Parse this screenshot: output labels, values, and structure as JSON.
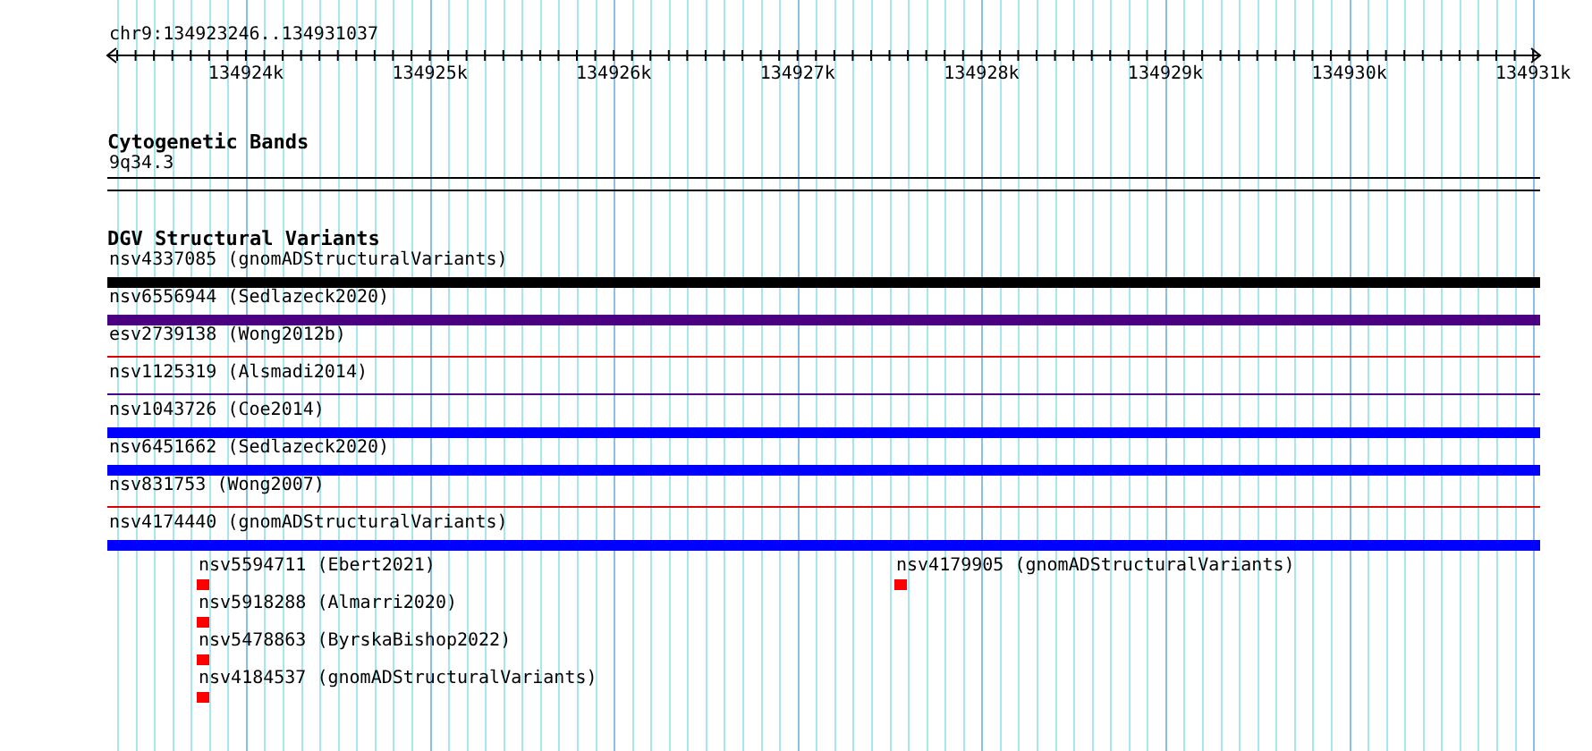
{
  "ruler": {
    "position": "chr9:134923246..134931037",
    "ticks": [
      "134924k",
      "134925k",
      "134926k",
      "134927k",
      "134928k",
      "134929k",
      "134930k",
      "134931k"
    ]
  },
  "cytogenetic_bands": {
    "title": "Cytogenetic Bands",
    "band": "9q34.3"
  },
  "dgv_track": {
    "title": "DGV Structural Variants",
    "variants": [
      {
        "label": "nsv4337085 (gnomADStructuralVariants)",
        "kind": "thick",
        "color": "#000000"
      },
      {
        "label": "nsv6556944 (Sedlazeck2020)",
        "kind": "thick",
        "color": "#4b0082"
      },
      {
        "label": "esv2739138 (Wong2012b)",
        "kind": "thin",
        "color": "#dd0000"
      },
      {
        "label": "nsv1125319 (Alsmadi2014)",
        "kind": "thin",
        "color": "#4b0082"
      },
      {
        "label": "nsv1043726 (Coe2014)",
        "kind": "thick",
        "color": "#0000ff"
      },
      {
        "label": "nsv6451662 (Sedlazeck2020)",
        "kind": "thick",
        "color": "#0000ff"
      },
      {
        "label": "nsv831753 (Wong2007)",
        "kind": "thin",
        "color": "#dd0000"
      },
      {
        "label": "nsv4174440 (gnomADStructuralVariants)",
        "kind": "thick",
        "color": "#0000ff"
      }
    ],
    "small_variant_groups": [
      {
        "items": [
          {
            "label": "nsv5594711 (Ebert2021)",
            "color": "#ff0000"
          },
          {
            "label": "nsv5918288 (Almarri2020)",
            "color": "#ff0000"
          },
          {
            "label": "nsv5478863 (ByrskaBishop2022)",
            "color": "#ff0000"
          },
          {
            "label": "nsv4184537 (gnomADStructuralVariants)",
            "color": "#ff0000"
          }
        ]
      },
      {
        "items": [
          {
            "label": "nsv4179905 (gnomADStructuralVariants)",
            "color": "#ff0000"
          }
        ]
      }
    ]
  }
}
